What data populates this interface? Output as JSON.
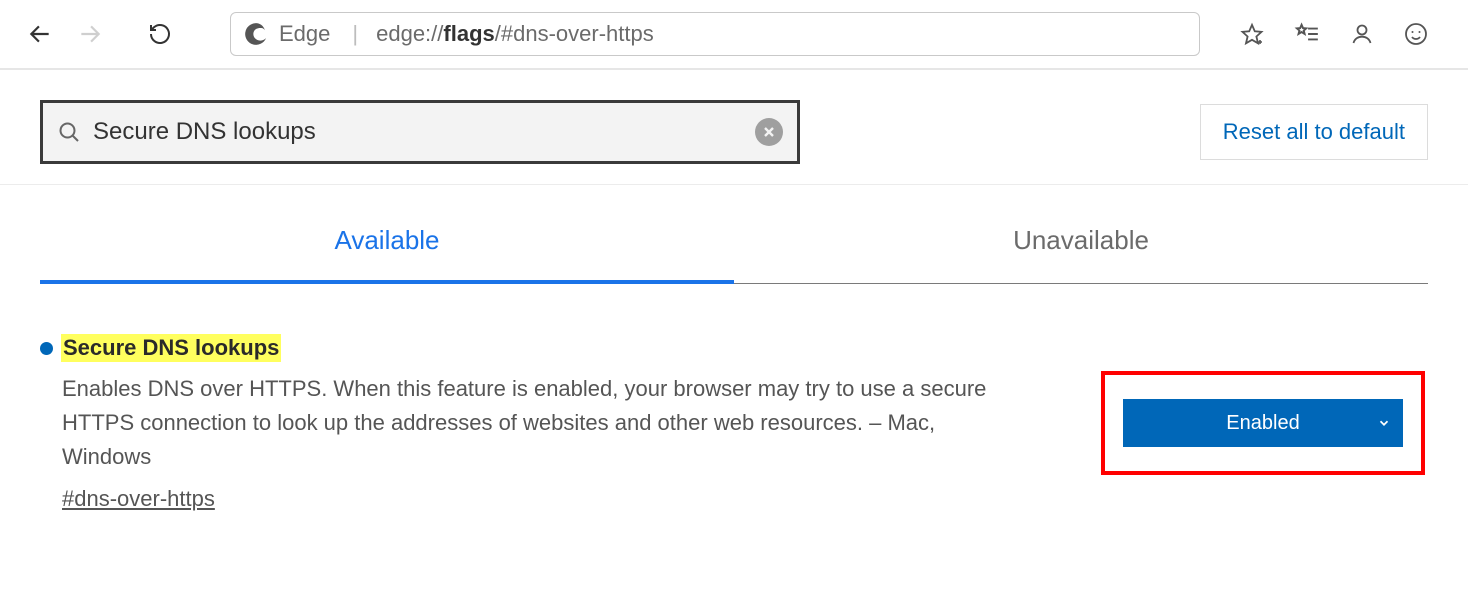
{
  "browser": {
    "product": "Edge",
    "url_prefix": "edge://",
    "url_bold": "flags",
    "url_suffix": "/#dns-over-https"
  },
  "flags_page": {
    "search_value": "Secure DNS lookups",
    "reset_label": "Reset all to default",
    "tabs": {
      "available": "Available",
      "unavailable": "Unavailable"
    },
    "flag": {
      "title": "Secure DNS lookups",
      "description": "Enables DNS over HTTPS. When this feature is enabled, your browser may try to use a secure HTTPS connection to look up the addresses of websites and other web resources. – Mac, Windows",
      "hash": "#dns-over-https",
      "selected_option": "Enabled"
    }
  }
}
